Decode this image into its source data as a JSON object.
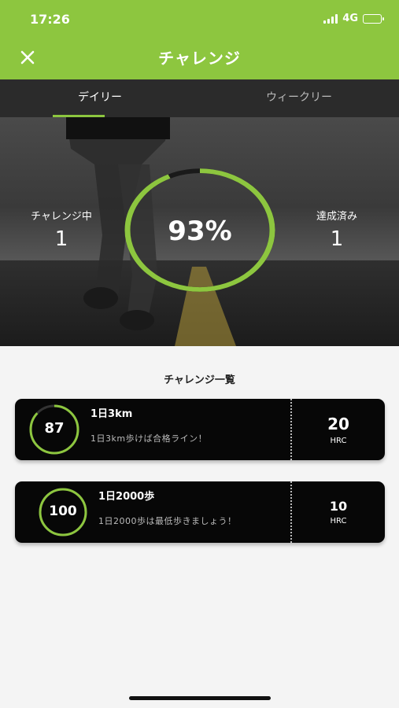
{
  "status_bar": {
    "time": "17:26",
    "network": "4G",
    "battery_icon": "battery-icon",
    "signal_icon": "signal-icon"
  },
  "nav": {
    "title": "チャレンジ",
    "close_icon": "close-icon"
  },
  "tabs": [
    {
      "label": "デイリー",
      "selected": true
    },
    {
      "label": "ウィークリー",
      "selected": false
    }
  ],
  "summary": {
    "in_progress_label": "チャレンジ中",
    "in_progress_value": "1",
    "progress_text": "93%",
    "progress_fraction": 0.93,
    "completed_label": "達成済み",
    "completed_value": "1"
  },
  "list": {
    "title": "チャレンジ一覧",
    "items": [
      {
        "title": "1日3km",
        "score": "87",
        "description": "1日3km歩けば合格ライン！",
        "reward_value": "20",
        "reward_unit": "HRC"
      },
      {
        "title": "1日2000歩",
        "score": "100",
        "description": "1日2000歩は最低歩きましょう！",
        "reward_value": "10",
        "reward_unit": "HRC"
      }
    ]
  },
  "colors": {
    "accent": "#8dc63f",
    "card": "#070707",
    "tab_bar": "#2b2b2b",
    "page": "#f4f4f4"
  }
}
